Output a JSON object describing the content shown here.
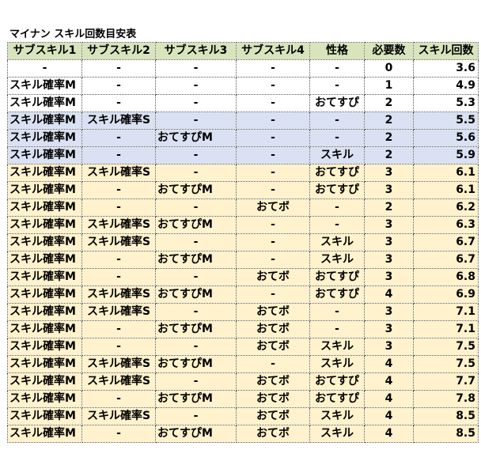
{
  "title": "マイナン スキル回数目安表",
  "headers": [
    "サブスキル1",
    "サブスキル2",
    "サブスキル3",
    "サブスキル4",
    "性格",
    "必要数",
    "スキル回数"
  ],
  "colors": {
    "header": "#d8e4bc",
    "white": "#ffffff",
    "blue": "#d9e1f2",
    "yellow": "#fff2cc"
  },
  "rows": [
    {
      "group": "white",
      "cells": [
        "-",
        "-",
        "-",
        "-",
        "-",
        "0",
        "3.6"
      ]
    },
    {
      "group": "white",
      "cells": [
        "スキル確率M",
        "-",
        "-",
        "-",
        "-",
        "1",
        "4.9"
      ]
    },
    {
      "group": "white",
      "cells": [
        "スキル確率M",
        "-",
        "-",
        "-",
        "おてすぴ",
        "2",
        "5.3"
      ]
    },
    {
      "group": "blue",
      "cells": [
        "スキル確率M",
        "スキル確率S",
        "-",
        "-",
        "-",
        "2",
        "5.5"
      ]
    },
    {
      "group": "blue",
      "cells": [
        "スキル確率M",
        "-",
        "おてすぴM",
        "-",
        "-",
        "2",
        "5.6"
      ]
    },
    {
      "group": "blue",
      "cells": [
        "スキル確率M",
        "-",
        "-",
        "-",
        "スキル",
        "2",
        "5.9"
      ]
    },
    {
      "group": "yellow",
      "cells": [
        "スキル確率M",
        "スキル確率S",
        "-",
        "-",
        "おてすぴ",
        "3",
        "6.1"
      ]
    },
    {
      "group": "yellow",
      "cells": [
        "スキル確率M",
        "-",
        "おてすぴM",
        "-",
        "おてすぴ",
        "3",
        "6.1"
      ]
    },
    {
      "group": "yellow",
      "cells": [
        "スキル確率M",
        "-",
        "-",
        "おてボ",
        "-",
        "2",
        "6.2"
      ]
    },
    {
      "group": "yellow",
      "cells": [
        "スキル確率M",
        "スキル確率S",
        "おてすぴM",
        "-",
        "-",
        "3",
        "6.3"
      ]
    },
    {
      "group": "yellow",
      "cells": [
        "スキル確率M",
        "スキル確率S",
        "-",
        "-",
        "スキル",
        "3",
        "6.7"
      ]
    },
    {
      "group": "yellow",
      "cells": [
        "スキル確率M",
        "-",
        "おてすぴM",
        "-",
        "スキル",
        "3",
        "6.7"
      ]
    },
    {
      "group": "yellow",
      "cells": [
        "スキル確率M",
        "-",
        "-",
        "おてボ",
        "おてすぴ",
        "3",
        "6.8"
      ]
    },
    {
      "group": "yellow",
      "cells": [
        "スキル確率M",
        "スキル確率S",
        "おてすぴM",
        "-",
        "おてすぴ",
        "4",
        "6.9"
      ]
    },
    {
      "group": "yellow",
      "cells": [
        "スキル確率M",
        "スキル確率S",
        "-",
        "おてボ",
        "-",
        "3",
        "7.1"
      ]
    },
    {
      "group": "yellow",
      "cells": [
        "スキル確率M",
        "-",
        "おてすぴM",
        "おてボ",
        "-",
        "3",
        "7.1"
      ]
    },
    {
      "group": "yellow",
      "cells": [
        "スキル確率M",
        "-",
        "-",
        "おてボ",
        "スキル",
        "3",
        "7.5"
      ]
    },
    {
      "group": "yellow",
      "cells": [
        "スキル確率M",
        "スキル確率S",
        "おてすぴM",
        "-",
        "スキル",
        "4",
        "7.5"
      ]
    },
    {
      "group": "yellow",
      "cells": [
        "スキル確率M",
        "スキル確率S",
        "-",
        "おてボ",
        "おてすぴ",
        "4",
        "7.7"
      ]
    },
    {
      "group": "yellow",
      "cells": [
        "スキル確率M",
        "-",
        "おてすぴM",
        "おてボ",
        "おてすぴ",
        "4",
        "7.8"
      ]
    },
    {
      "group": "yellow",
      "cells": [
        "スキル確率M",
        "スキル確率S",
        "-",
        "おてボ",
        "スキル",
        "4",
        "8.5"
      ]
    },
    {
      "group": "yellow",
      "cells": [
        "スキル確率M",
        "-",
        "おてすぴM",
        "おてボ",
        "スキル",
        "4",
        "8.5"
      ]
    }
  ]
}
